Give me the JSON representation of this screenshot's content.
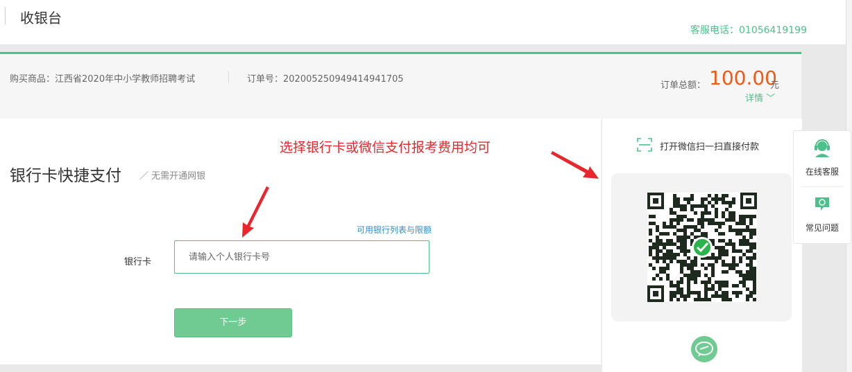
{
  "header": {
    "title": "收银台",
    "hotline": "客服电话：01056419199"
  },
  "order": {
    "goods": "购买商品：江西省2020年中小学教师招聘考试",
    "order_no": "订单号：20200525094941494170​5",
    "total_label": "订单总额：",
    "total_amount": "100.00",
    "total_unit": "元",
    "details_label": "详情 ﹀"
  },
  "bank_pay": {
    "title": "银行卡快捷支付",
    "subtitle": "／ 无需开通网银",
    "bank_list_link": "可用银行列表与限额",
    "card_label": "银行卡",
    "card_placeholder": "请输入个人银行卡号",
    "next_button": "下一步"
  },
  "annotation": {
    "text": "选择银行卡或微信支付报考费用均可",
    "color": "#e8262b"
  },
  "wechat_pay": {
    "scan_hint": "打开微信扫一扫直接付款",
    "icons": [
      "scan-icon",
      "qr-code",
      "wechat-icon"
    ]
  },
  "side_help": {
    "items": [
      {
        "label": "在线客服",
        "icon": "customer-service-icon"
      },
      {
        "label": "常见问题",
        "icon": "faq-icon"
      }
    ]
  },
  "colors": {
    "accent": "#4cc08a",
    "amount": "#f05a14",
    "link": "#2a8fd5",
    "button": "#6fcb91"
  }
}
